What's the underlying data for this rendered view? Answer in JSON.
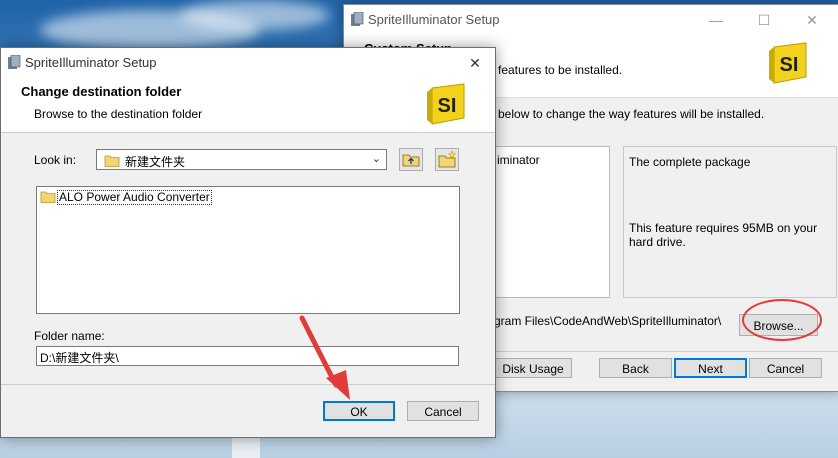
{
  "back_window": {
    "title": "SpriteIlluminator Setup",
    "header_title": "Custom Setup",
    "header_subtitle": "features to be installed.",
    "instruction": "below to change the way features will be installed.",
    "tree_item": "iminator",
    "feature_description": "The complete package",
    "feature_requirement": "This feature requires 95MB on your hard drive.",
    "install_path": "gram Files\\CodeAndWeb\\SpriteIlluminator\\",
    "browse_label": "Browse...",
    "disk_usage_label": "Disk Usage",
    "back_label": "Back",
    "next_label": "Next",
    "cancel_label": "Cancel",
    "minimize_glyph": "—",
    "maximize_glyph": "☐",
    "close_glyph": "✕"
  },
  "logo_text": "SI",
  "front_dialog": {
    "title": "SpriteIlluminator Setup",
    "close_glyph": "✕",
    "header_title": "Change destination folder",
    "header_subtitle": "Browse to the destination folder",
    "look_in_label": "Look in:",
    "look_in_value": "新建文件夹",
    "folders": [
      "ALO Power Audio Converter"
    ],
    "folder_name_label": "Folder name:",
    "folder_name_value": "D:\\新建文件夹\\",
    "ok_label": "OK",
    "cancel_label": "Cancel"
  },
  "colors": {
    "accent": "#0078d7",
    "annotation": "#e23b3b",
    "logo_yellow": "#f2d21b"
  }
}
